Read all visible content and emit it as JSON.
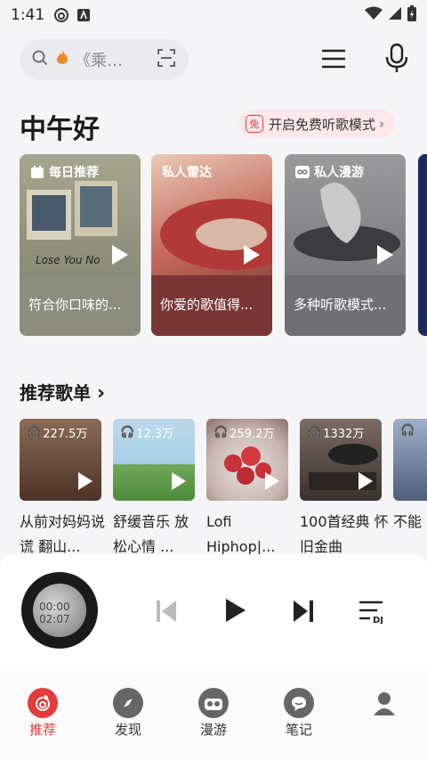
{
  "status": {
    "time": "1:41"
  },
  "search": {
    "query": "《乘…"
  },
  "greeting": "中午好",
  "free_mode": {
    "badge": "免",
    "label": "开启免费听歌模式"
  },
  "features": [
    {
      "tag": "每日推荐",
      "desc": "符合你口味的...",
      "bg": "#8d8f7e",
      "art": "Lose You No"
    },
    {
      "tag": "私人雷达",
      "desc": "你爱的歌值得...",
      "bg": "#8a3f3a"
    },
    {
      "tag": "私人漫游",
      "desc": "多种听歌模式...",
      "bg": "#7f7f85"
    }
  ],
  "section": {
    "title": "推荐歌单"
  },
  "playlists": [
    {
      "count": "227.5万",
      "title": "从前对妈妈说谎 翻山...",
      "bg": "#6e4a3a"
    },
    {
      "count": "12.3万",
      "title": "舒缓音乐 放松心情 ...",
      "bg": "#9fc5df"
    },
    {
      "count": "259.2万",
      "title": "Lofi Hiphop|...",
      "bg": "#c7a39c"
    },
    {
      "count": "1332万",
      "title": "100首经典 怀旧金曲",
      "bg": "#5a4e48"
    },
    {
      "count": "",
      "title": "不能 从此",
      "bg": "#7b8eaa"
    }
  ],
  "player": {
    "time_elapsed": "00:00",
    "time_total": "02:07"
  },
  "nav": [
    {
      "label": "推荐",
      "icon": "netease-logo-icon",
      "active": true
    },
    {
      "label": "发现",
      "icon": "compass-icon",
      "active": false
    },
    {
      "label": "漫游",
      "icon": "radio-icon",
      "active": false
    },
    {
      "label": "笔记",
      "icon": "chat-bubble-icon",
      "active": false
    },
    {
      "label": "",
      "icon": "profile-icon",
      "active": false
    }
  ],
  "colors": {
    "accent": "#e53b3b",
    "background": "#f5f5f7"
  }
}
